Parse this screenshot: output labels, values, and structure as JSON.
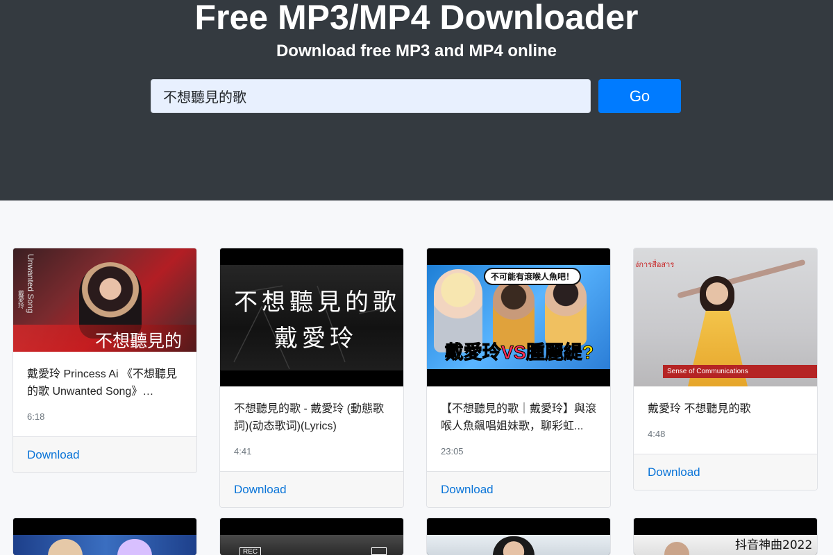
{
  "header": {
    "title": "Free MP3/MP4 Downloader",
    "subtitle": "Download free MP3 and MP4 online"
  },
  "search": {
    "value": "不想聽見的歌",
    "button_label": "Go"
  },
  "results": [
    {
      "title": "戴愛玲 Princess Ai 《不想聽見的歌 Unwanted Song》Officia...",
      "duration": "6:18",
      "download_label": "Download",
      "thumb_text": "不想聽見的歌",
      "thumb_side_text": "Unwanted Song",
      "thumb_artist": "戴愛玲"
    },
    {
      "title": "不想聽見的歌 - 戴愛玲 (動態歌詞)(动态歌词)(Lyrics)",
      "duration": "4:41",
      "download_label": "Download",
      "thumb_line1": "不想聽見的歌",
      "thumb_line2": "戴愛玲"
    },
    {
      "title": "【不想聽見的歌｜戴愛玲】與滾喉人魚飆唱姐妹歌，聊彩虹...",
      "duration": "23:05",
      "download_label": "Download",
      "thumb_bubble": "不可能有滾喉人魚吧！",
      "thumb_name1": "戴愛玲",
      "thumb_vs": "VS",
      "thumb_name2": "腫麗緹?"
    },
    {
      "title": "戴愛玲 不想聽見的歌",
      "duration": "4:48",
      "download_label": "Download",
      "thumb_corner": "ง่การสื่อสาร",
      "thumb_banner": "Sense of Communications"
    },
    {
      "thumb_tag": "REC"
    },
    {},
    {},
    {
      "thumb_text": "抖音神曲2022"
    }
  ]
}
